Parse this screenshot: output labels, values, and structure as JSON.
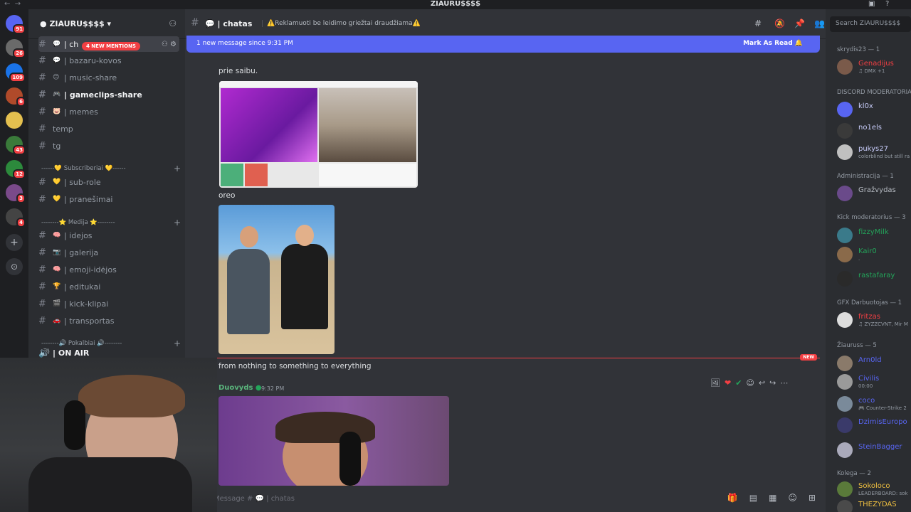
{
  "window": {
    "title": "ZIAURU$$$$"
  },
  "server": {
    "name": "ZIAURU$$$$"
  },
  "guilds": [
    {
      "badge": "91",
      "color": "#5865f2"
    },
    {
      "badge": "26",
      "color": "#6a6a6a"
    },
    {
      "badge": "109",
      "color": "#1a73e8"
    },
    {
      "badge": "6",
      "color": "#b04a2a"
    },
    {
      "badge": "",
      "color": "#e4c04f"
    },
    {
      "badge": "43",
      "color": "#3a7a3a"
    },
    {
      "badge": "12",
      "color": "#2c8a3c"
    },
    {
      "badge": "3",
      "color": "#7a4a8a"
    },
    {
      "badge": "4",
      "color": "#444444"
    }
  ],
  "channels": {
    "mentions_pill": "4 NEW MENTIONS",
    "items": [
      {
        "name": "| ch",
        "emoji": "💬"
      },
      {
        "name": "| bazaru-kovos",
        "emoji": "💬"
      },
      {
        "name": "| music-share",
        "emoji": "😊"
      },
      {
        "name": "| gameclips-share",
        "emoji": "🎮"
      },
      {
        "name": "| memes",
        "emoji": "🐷"
      },
      {
        "name": "temp",
        "emoji": ""
      },
      {
        "name": "tg",
        "emoji": ""
      }
    ],
    "cat_subs": "------💛 Subscriberiai 💛------",
    "subs_items": [
      {
        "name": "| sub-role",
        "emoji": "💛"
      },
      {
        "name": "| pranešimai",
        "emoji": "💛"
      }
    ],
    "cat_media": "--------⭐ Medija ⭐--------",
    "media_items": [
      {
        "name": "| idejos",
        "emoji": "🧠"
      },
      {
        "name": "| galerija",
        "emoji": "📷"
      },
      {
        "name": "| emoji-idėjos",
        "emoji": "🧠"
      },
      {
        "name": "| editukai",
        "emoji": "🏆"
      },
      {
        "name": "| kick-klipai",
        "emoji": "🎬"
      },
      {
        "name": "| transportas",
        "emoji": "🚗"
      }
    ],
    "cat_voice": "--------🔊 Pokalbiai 🔊--------",
    "voice_item": "| ON AIR"
  },
  "channel_header": {
    "name": "| chatas",
    "topic": "⚠️Reklamuoti be leidimo griežtai draudžiama⚠️",
    "search_placeholder": "Search ZIAURU$$$$"
  },
  "new_message_bar": {
    "text": "1 new message since 9:31 PM",
    "action": "Mark As Read"
  },
  "messages": [
    {
      "text": "prie saibu."
    },
    {
      "text": "oreo"
    },
    {
      "text": "from nothing to something to everything"
    },
    {
      "author": "Duovyds",
      "timestamp": "9:32 PM"
    }
  ],
  "new_divider": "NEW",
  "composer": {
    "placeholder": "Message # 💬 | chatas"
  },
  "members": {
    "groups": [
      {
        "name": "skrydis23 — 1",
        "members": [
          {
            "name": "Genadijus",
            "status": "♫ DMX +1",
            "color": "#f23f43"
          }
        ]
      },
      {
        "name": "DISCORD MODERATORIAI",
        "members": [
          {
            "name": "kl0x",
            "status": "",
            "color": "#c9cdfb"
          },
          {
            "name": "no1els",
            "status": "",
            "color": "#c9cdfb"
          },
          {
            "name": "pukys27",
            "status": "colorblind but still ra",
            "color": "#c9cdfb"
          }
        ]
      },
      {
        "name": "Administracija — 1",
        "members": [
          {
            "name": "Gražvydas",
            "status": "",
            "color": "#b5bac1"
          }
        ]
      },
      {
        "name": "Kick moderatorius — 3",
        "members": [
          {
            "name": "fizzyMilk",
            "status": "",
            "color": "#23a55a"
          },
          {
            "name": "Kair0",
            "status": ".",
            "color": "#23a55a"
          },
          {
            "name": "rastafaray",
            "status": "",
            "color": "#23a55a"
          }
        ]
      },
      {
        "name": "GFX Darbuotojas — 1",
        "members": [
          {
            "name": "fritzas",
            "status": "♫ ZYZZCVNT, Mir M",
            "color": "#f23f43"
          }
        ]
      },
      {
        "name": "Žiauruss — 5",
        "members": [
          {
            "name": "Arn0ld",
            "status": "",
            "color": "#5865f2"
          },
          {
            "name": "Civilis",
            "status": "00:00",
            "color": "#5865f2"
          },
          {
            "name": "coco",
            "status": "🎮 Counter-Strike 2",
            "color": "#5865f2"
          },
          {
            "name": "DzimisEuropo",
            "status": "",
            "color": "#5865f2"
          },
          {
            "name": "SteinBagger",
            "status": "",
            "color": "#5865f2"
          }
        ]
      },
      {
        "name": "Kolega — 2",
        "members": [
          {
            "name": "Sokoloco",
            "status": "LEADERBOARD: sok",
            "color": "#f0c040"
          },
          {
            "name": "THEZYDAS",
            "status": "",
            "color": "#f0c040"
          }
        ]
      }
    ]
  }
}
